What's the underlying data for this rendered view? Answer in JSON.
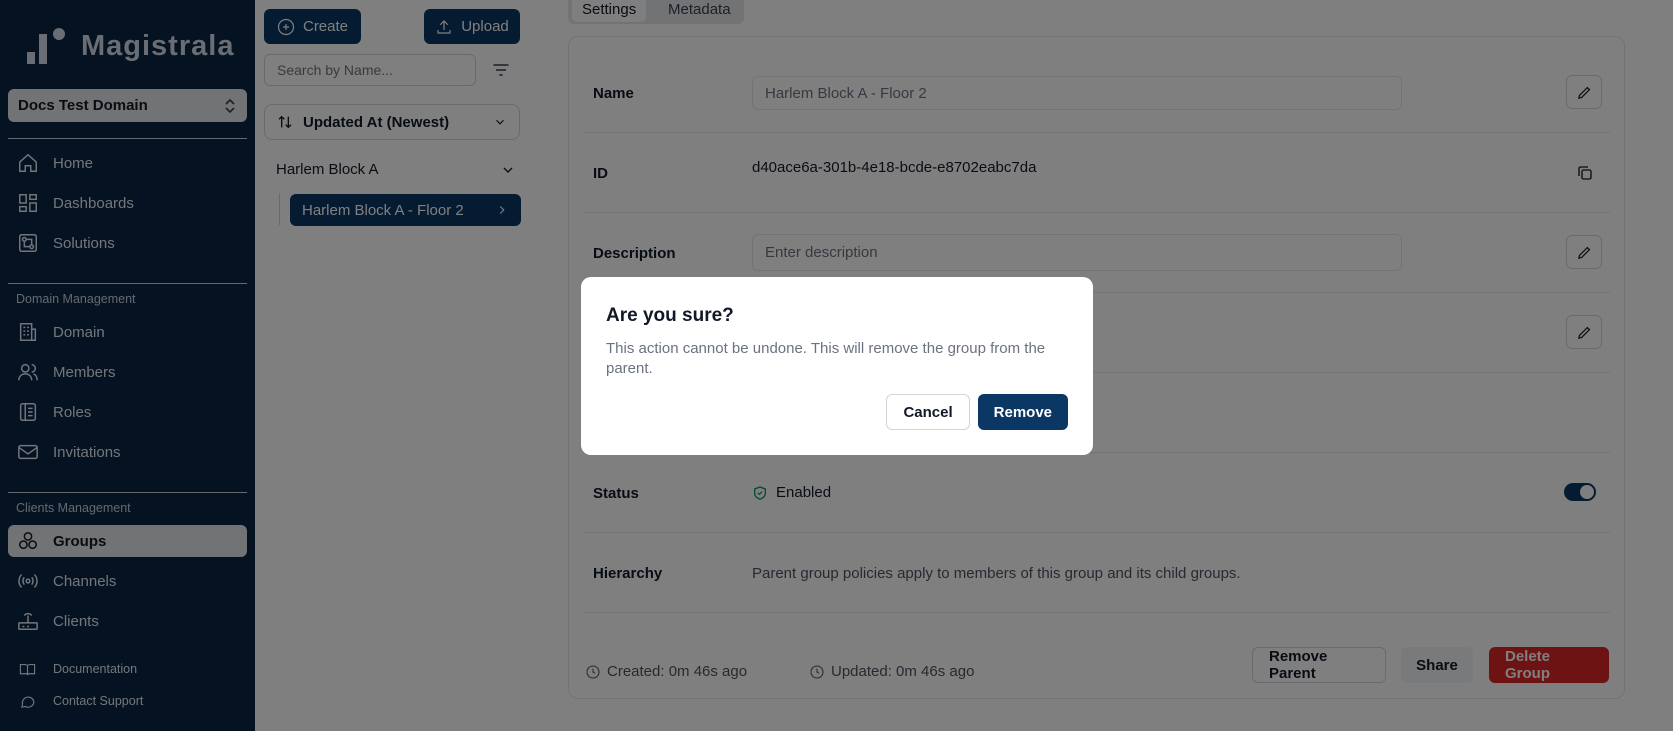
{
  "app": {
    "name": "Magistrala"
  },
  "sidebar": {
    "domain_selector": "Docs Test Domain",
    "primary": [
      {
        "label": "Home",
        "icon": "home-icon"
      },
      {
        "label": "Dashboards",
        "icon": "dashboard-icon"
      },
      {
        "label": "Solutions",
        "icon": "solutions-icon"
      }
    ],
    "domain_section": "Domain Management",
    "domain_items": [
      {
        "label": "Domain",
        "icon": "building-icon"
      },
      {
        "label": "Members",
        "icon": "members-icon"
      },
      {
        "label": "Roles",
        "icon": "roles-icon"
      },
      {
        "label": "Invitations",
        "icon": "mail-icon"
      }
    ],
    "clients_section": "Clients Management",
    "clients_items": [
      {
        "label": "Groups",
        "icon": "groups-icon",
        "active": true
      },
      {
        "label": "Channels",
        "icon": "broadcast-icon"
      },
      {
        "label": "Clients",
        "icon": "router-icon"
      }
    ],
    "footer_items": [
      {
        "label": "Documentation",
        "icon": "book-icon"
      },
      {
        "label": "Contact Support",
        "icon": "chat-icon"
      }
    ]
  },
  "groups_panel": {
    "create_label": "Create",
    "upload_label": "Upload",
    "search_placeholder": "Search by Name...",
    "sort_label": "Updated At (Newest)",
    "tree_parent": "Harlem Block A",
    "tree_child": "Harlem Block A - Floor 2"
  },
  "detail": {
    "tabs": [
      "Settings",
      "Metadata"
    ],
    "name_label": "Name",
    "name_value": "Harlem Block A - Floor 2",
    "id_label": "ID",
    "id_value": "d40ace6a-301b-4e18-bcde-e8702eabc7da",
    "description_label": "Description",
    "description_placeholder": "Enter description",
    "status_label": "Status",
    "status_value": "Enabled",
    "hierarchy_label": "Hierarchy",
    "hierarchy_text": "Parent group policies apply to members of this group and its child groups.",
    "created": "Created: 0m 46s ago",
    "updated": "Updated: 0m 46s ago",
    "remove_parent_label": "Remove Parent",
    "share_label": "Share",
    "delete_label": "Delete Group"
  },
  "dialog": {
    "title": "Are you sure?",
    "description": "This action cannot be undone. This will remove the group from the parent.",
    "cancel_label": "Cancel",
    "confirm_label": "Remove"
  },
  "colors": {
    "sidebar_bg": "#0b2545",
    "primary": "#0b3764",
    "danger": "#dc2626"
  }
}
